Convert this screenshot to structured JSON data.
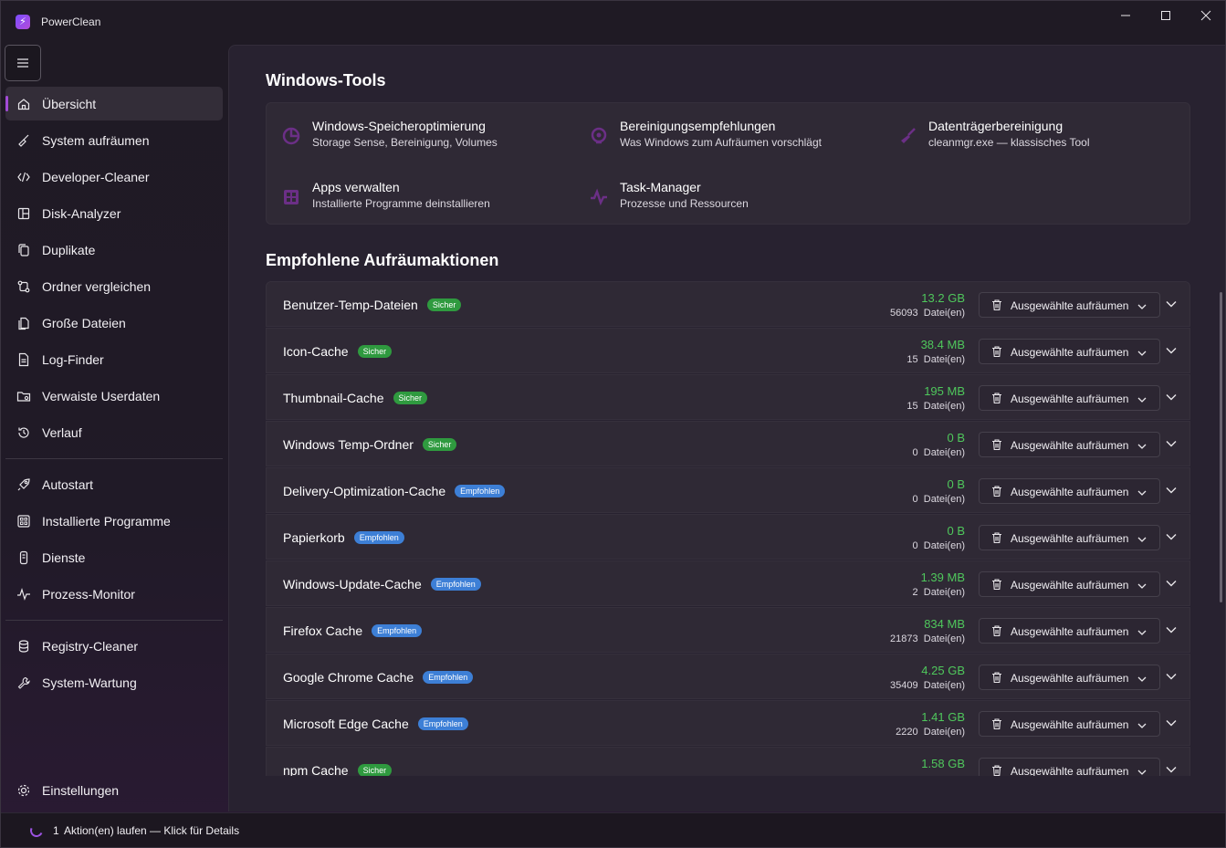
{
  "app": {
    "title": "PowerClean",
    "logo_glyph": "⚡",
    "accent": "#a24bd6"
  },
  "window": {
    "minimize": "—",
    "maximize": "☐",
    "close": "✕"
  },
  "sidebar": {
    "groups": [
      [
        {
          "id": "uebersicht",
          "label": "Übersicht",
          "icon": "home-icon",
          "active": true
        },
        {
          "id": "system-aufraeumen",
          "label": "System aufräumen",
          "icon": "broom-icon"
        },
        {
          "id": "developer-cleaner",
          "label": "Developer-Cleaner",
          "icon": "code-icon"
        },
        {
          "id": "disk-analyzer",
          "label": "Disk-Analyzer",
          "icon": "layout-icon"
        },
        {
          "id": "duplikate",
          "label": "Duplikate",
          "icon": "copy-icon"
        },
        {
          "id": "ordner-vergleichen",
          "label": "Ordner vergleichen",
          "icon": "compare-icon"
        },
        {
          "id": "grosse-dateien",
          "label": "Große Dateien",
          "icon": "files-icon"
        },
        {
          "id": "log-finder",
          "label": "Log-Finder",
          "icon": "document-icon"
        },
        {
          "id": "verwaiste-userdaten",
          "label": "Verwaiste Userdaten",
          "icon": "folder-icon"
        },
        {
          "id": "verlauf",
          "label": "Verlauf",
          "icon": "history-icon"
        }
      ],
      [
        {
          "id": "autostart",
          "label": "Autostart",
          "icon": "rocket-icon"
        },
        {
          "id": "installierte-programme",
          "label": "Installierte Programme",
          "icon": "apps-icon"
        },
        {
          "id": "dienste",
          "label": "Dienste",
          "icon": "server-icon"
        },
        {
          "id": "prozess-monitor",
          "label": "Prozess-Monitor",
          "icon": "pulse-icon"
        }
      ],
      [
        {
          "id": "registry-cleaner",
          "label": "Registry-Cleaner",
          "icon": "database-icon"
        },
        {
          "id": "system-wartung",
          "label": "System-Wartung",
          "icon": "wrench-icon"
        }
      ]
    ],
    "settings": {
      "label": "Einstellungen",
      "icon": "gear-icon"
    }
  },
  "tools_section": {
    "title": "Windows-Tools",
    "tools": [
      {
        "title": "Windows-Speicheroptimierung",
        "desc": "Storage Sense, Bereinigung, Volumes",
        "icon": "pie-chart-icon"
      },
      {
        "title": "Bereinigungsempfehlungen",
        "desc": "Was Windows zum Aufräumen vorschlägt",
        "icon": "lightbulb-icon"
      },
      {
        "title": "Datenträgerbereinigung",
        "desc": "cleanmgr.exe — klassisches Tool",
        "icon": "broom-icon"
      },
      {
        "title": "Apps verwalten",
        "desc": "Installierte Programme deinstallieren",
        "icon": "apps-icon"
      },
      {
        "title": "Task-Manager",
        "desc": "Prozesse und Ressourcen",
        "icon": "pulse-icon"
      }
    ]
  },
  "actions_section": {
    "title": "Empfohlene Aufräumaktionen",
    "button_label": "Ausgewählte aufräumen",
    "files_suffix": "Datei(en)",
    "colors": {
      "safe": "#2f9a3f",
      "recommended": "#3d7fd6",
      "size": "#4fc85c"
    },
    "rows": [
      {
        "name": "Benutzer-Temp-Dateien",
        "badge": "Sicher",
        "badge_type": "safe",
        "size": "13.2 GB",
        "files": "56093"
      },
      {
        "name": "Icon-Cache",
        "badge": "Sicher",
        "badge_type": "safe",
        "size": "38.4 MB",
        "files": "15"
      },
      {
        "name": "Thumbnail-Cache",
        "badge": "Sicher",
        "badge_type": "safe",
        "size": "195 MB",
        "files": "15"
      },
      {
        "name": "Windows Temp-Ordner",
        "badge": "Sicher",
        "badge_type": "safe",
        "size": "0 B",
        "files": "0"
      },
      {
        "name": "Delivery-Optimization-Cache",
        "badge": "Empfohlen",
        "badge_type": "rec",
        "size": "0 B",
        "files": "0"
      },
      {
        "name": "Papierkorb",
        "badge": "Empfohlen",
        "badge_type": "rec",
        "size": "0 B",
        "files": "0"
      },
      {
        "name": "Windows-Update-Cache",
        "badge": "Empfohlen",
        "badge_type": "rec",
        "size": "1.39 MB",
        "files": "2"
      },
      {
        "name": "Firefox Cache",
        "badge": "Empfohlen",
        "badge_type": "rec",
        "size": "834 MB",
        "files": "21873"
      },
      {
        "name": "Google Chrome Cache",
        "badge": "Empfohlen",
        "badge_type": "rec",
        "size": "4.25 GB",
        "files": "35409"
      },
      {
        "name": "Microsoft Edge Cache",
        "badge": "Empfohlen",
        "badge_type": "rec",
        "size": "1.41 GB",
        "files": "2220"
      },
      {
        "name": "npm Cache",
        "badge": "Sicher",
        "badge_type": "safe",
        "size": "1.58 GB",
        "files": ""
      }
    ]
  },
  "statusbar": {
    "count": "1",
    "text": "Aktion(en) laufen — Klick für Details"
  }
}
